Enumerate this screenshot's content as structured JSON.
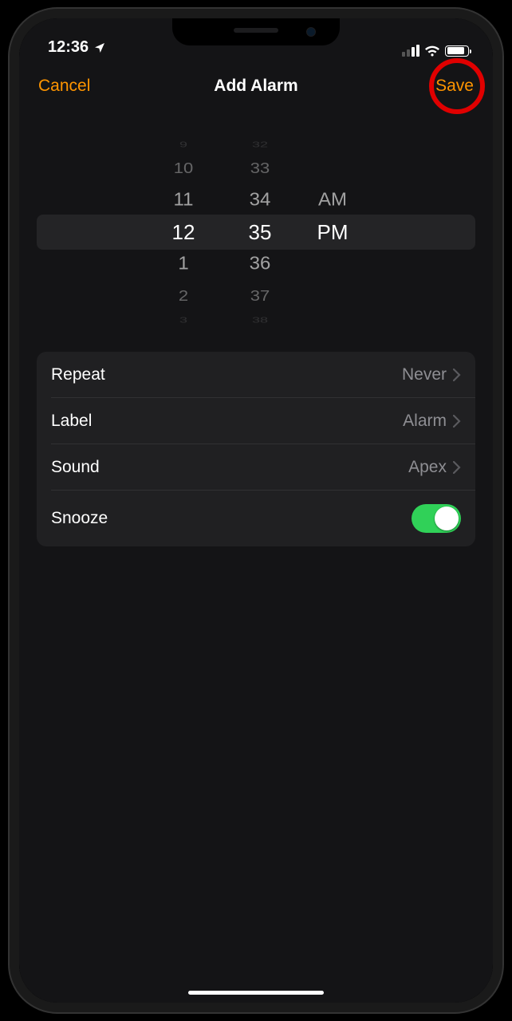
{
  "status": {
    "time": "12:36"
  },
  "nav": {
    "cancel": "Cancel",
    "title": "Add Alarm",
    "save": "Save"
  },
  "picker": {
    "hours": {
      "m3": "9",
      "m2": "10",
      "m1": "11",
      "sel": "12",
      "p1": "1",
      "p2": "2",
      "p3": "3"
    },
    "minutes": {
      "m3": "32",
      "m2": "33",
      "m1": "34",
      "sel": "35",
      "p1": "36",
      "p2": "37",
      "p3": "38"
    },
    "ampm": {
      "m1": "AM",
      "sel": "PM"
    }
  },
  "settings": {
    "repeat": {
      "label": "Repeat",
      "value": "Never"
    },
    "label": {
      "label": "Label",
      "value": "Alarm"
    },
    "sound": {
      "label": "Sound",
      "value": "Apex"
    },
    "snooze": {
      "label": "Snooze",
      "on": true
    }
  }
}
